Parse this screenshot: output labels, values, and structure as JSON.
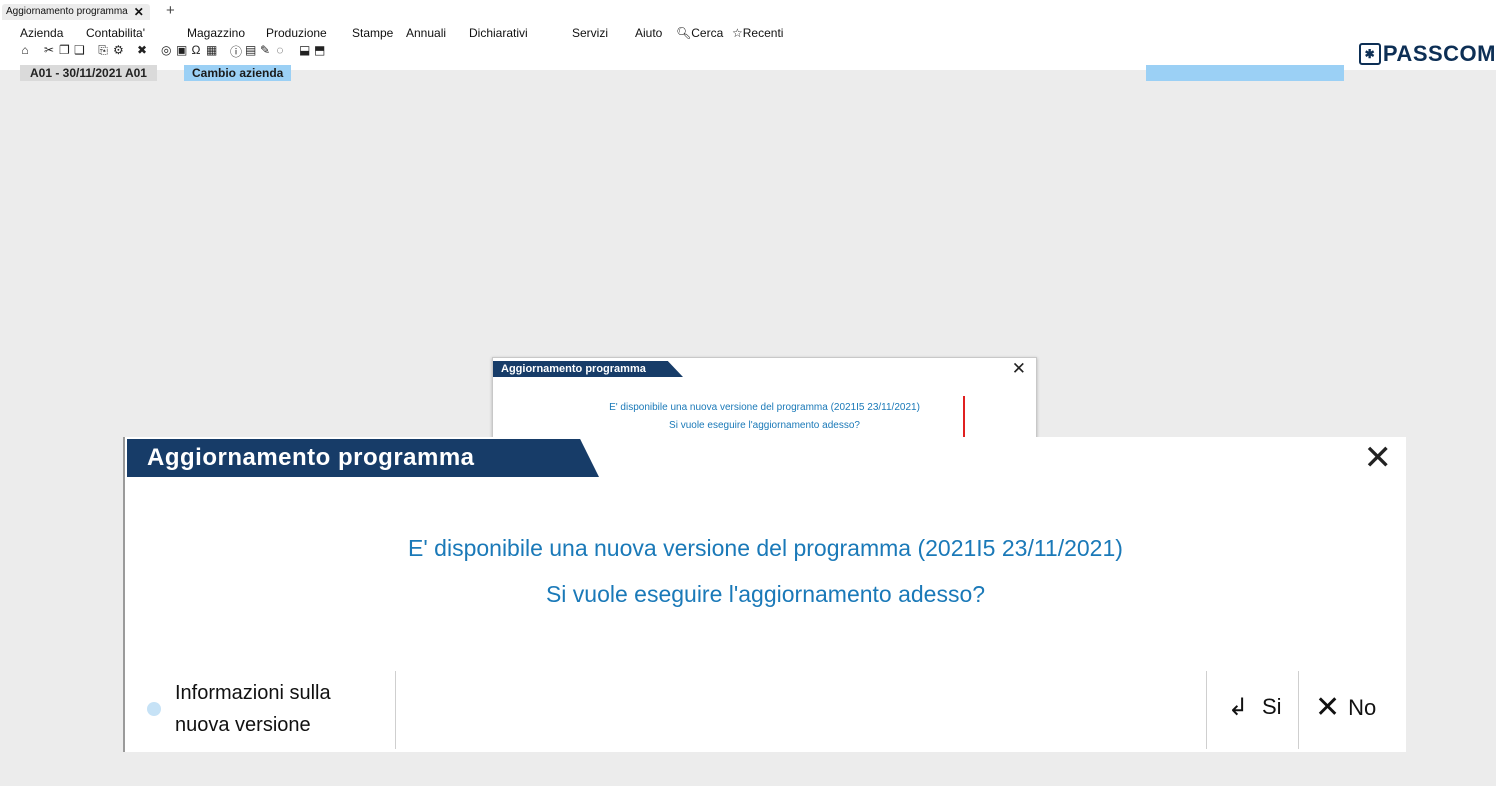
{
  "window_tab": {
    "title": "Aggiornamento programma",
    "close": "✕",
    "new_tab": "+"
  },
  "menu": {
    "items": [
      {
        "label": "Azienda"
      },
      {
        "label": "Contabilita'"
      },
      {
        "label": "Magazzino"
      },
      {
        "label": "Produzione"
      },
      {
        "label": "Stampe"
      },
      {
        "label": "Annuali"
      },
      {
        "label": "Dichiarativi"
      },
      {
        "label": "Servizi"
      },
      {
        "label": "Aiuto"
      },
      {
        "label": "Cerca",
        "icon": "search-icon"
      },
      {
        "label": "Recenti",
        "icon": "star-icon"
      }
    ]
  },
  "brand": {
    "logo_text": "PASSCOM"
  },
  "statusbar": {
    "company": "A01 - 30/11/2021  A01",
    "change_company": "Cambio azienda"
  },
  "small_dialog": {
    "title": "Aggiornamento programma",
    "line1": "E' disponibile una nuova versione del programma (2021I5 23/11/2021)",
    "line2": "Si vuole eseguire l'aggiornamento adesso?"
  },
  "big_dialog": {
    "title": "Aggiornamento programma",
    "line1": "E' disponibile una nuova versione del programma (2021I5 23/11/2021)",
    "line2": "Si vuole eseguire l'aggiornamento adesso?",
    "info_line1": "Informazioni sulla",
    "info_line2": "nuova versione",
    "yes_label": "Si",
    "no_label": "No"
  },
  "colors": {
    "title_bar": "#173c68",
    "message_text": "#1a79b8",
    "accent_light": "#c6e2f6",
    "arrow": "#e02020",
    "status_blue": "#9bd0f5"
  }
}
